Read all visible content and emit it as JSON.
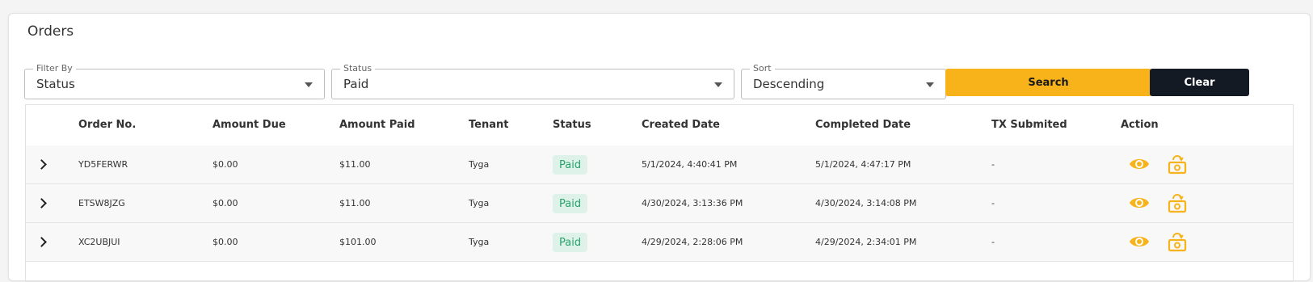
{
  "page": {
    "title": "Orders"
  },
  "filters": {
    "filter_by": {
      "label": "Filter By",
      "value": "Status"
    },
    "status": {
      "label": "Status",
      "value": "Paid"
    },
    "sort": {
      "label": "Sort",
      "value": "Descending"
    }
  },
  "buttons": {
    "search": "Search",
    "clear": "Clear"
  },
  "table": {
    "columns": [
      "Order No.",
      "Amount Due",
      "Amount Paid",
      "Tenant",
      "Status",
      "Created Date",
      "Completed Date",
      "TX Submited",
      "Action"
    ],
    "rows": [
      {
        "order_no": "YD5FERWR",
        "amount_due": "$0.00",
        "amount_paid": "$11.00",
        "tenant": "Tyga",
        "status": "Paid",
        "created": "5/1/2024, 4:40:41 PM",
        "completed": "5/1/2024, 4:47:17 PM",
        "tx": "-"
      },
      {
        "order_no": "ETSW8JZG",
        "amount_due": "$0.00",
        "amount_paid": "$11.00",
        "tenant": "Tyga",
        "status": "Paid",
        "created": "4/30/2024, 3:13:36 PM",
        "completed": "4/30/2024, 3:14:08 PM",
        "tx": "-"
      },
      {
        "order_no": "XC2UBJUI",
        "amount_due": "$0.00",
        "amount_paid": "$101.00",
        "tenant": "Tyga",
        "status": "Paid",
        "created": "4/29/2024, 2:28:06 PM",
        "completed": "4/29/2024, 2:34:01 PM",
        "tx": "-"
      }
    ]
  },
  "icons": {
    "expand": "chevron-right-icon",
    "view": "eye-icon",
    "refund": "refund-icon"
  },
  "colors": {
    "accent": "#f8b31a",
    "dark": "#141a24",
    "paid_bg": "#dff2ea",
    "paid_text": "#27a36a"
  }
}
